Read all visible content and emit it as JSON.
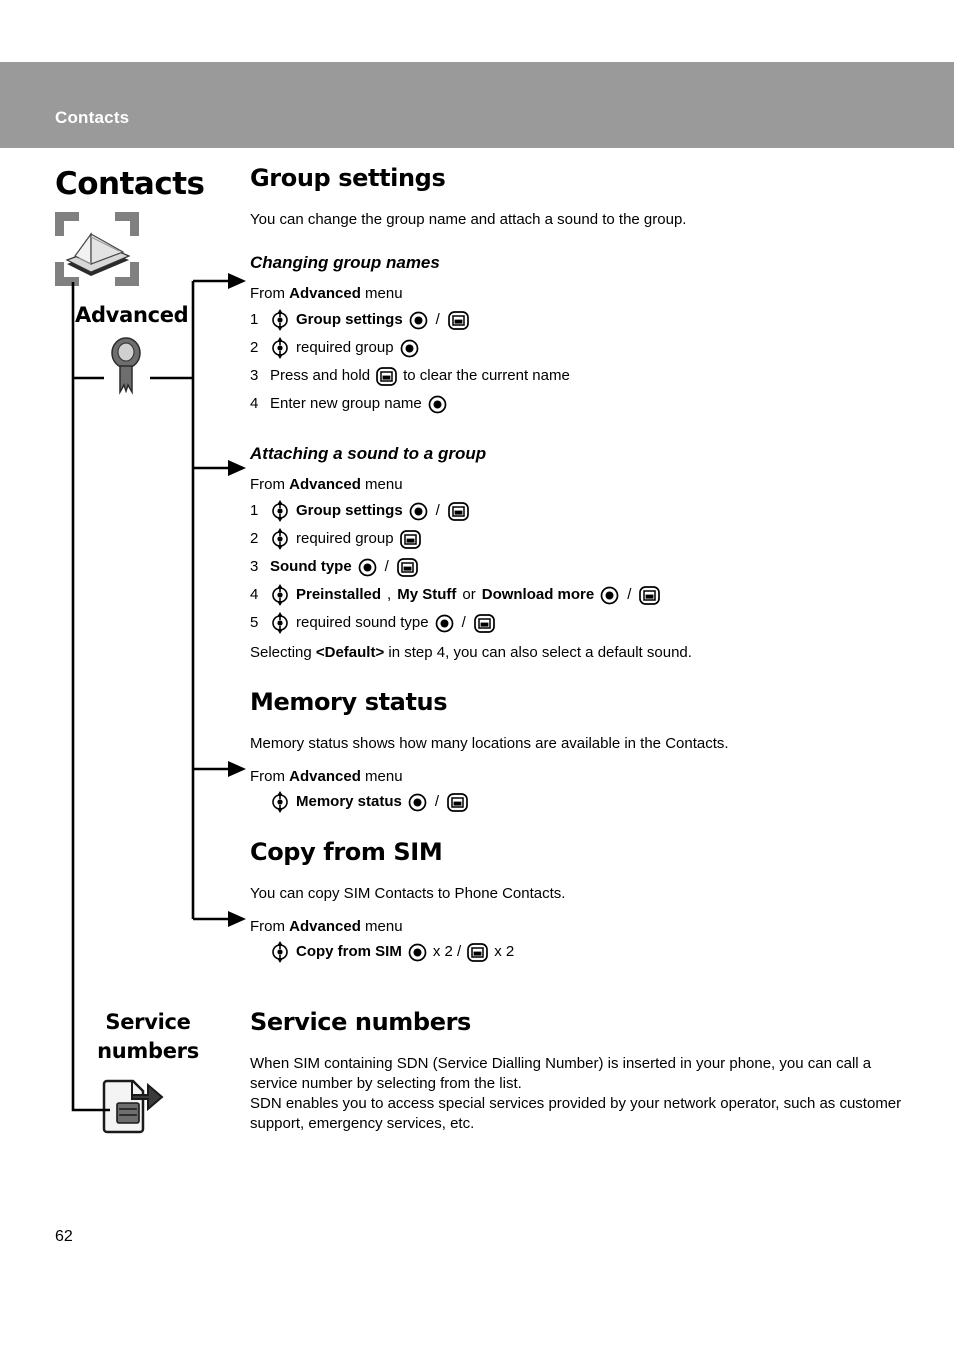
{
  "header": {
    "title": "Contacts"
  },
  "nav": {
    "title": "Contacts",
    "contacts_icon": "rolodex-card-file-icon",
    "advanced_label": "Advanced",
    "advanced_icon": "key-icon",
    "service_label": "Service numbers",
    "service_icon": "sim-card-arrow-icon"
  },
  "icons": {
    "nav_key": "navigation-key-icon",
    "select_key": "select-key-icon",
    "back_key": "back-key-icon"
  },
  "sections": [
    {
      "id": "group-settings",
      "heading": "Group settings",
      "intro": "You can change the group name and attach a sound to the group.",
      "subsections": [
        {
          "id": "changing-group-names",
          "subheading": "Changing group names",
          "from_prefix": "From ",
          "from_bold": "Advanced",
          "from_suffix": " menu",
          "steps": [
            {
              "num": "1",
              "parts": [
                {
                  "t": "icon",
                  "v": "nav"
                },
                {
                  "t": "bold",
                  "v": "Group settings"
                },
                {
                  "t": "icon",
                  "v": "select"
                },
                {
                  "t": "text",
                  "v": "/"
                },
                {
                  "t": "icon",
                  "v": "back"
                }
              ]
            },
            {
              "num": "2",
              "parts": [
                {
                  "t": "icon",
                  "v": "nav"
                },
                {
                  "t": "text",
                  "v": "required group"
                },
                {
                  "t": "icon",
                  "v": "select"
                }
              ]
            },
            {
              "num": "3",
              "parts": [
                {
                  "t": "text",
                  "v": "Press and hold"
                },
                {
                  "t": "icon",
                  "v": "back"
                },
                {
                  "t": "text",
                  "v": "to clear the current name"
                }
              ]
            },
            {
              "num": "4",
              "parts": [
                {
                  "t": "text",
                  "v": "Enter new group name"
                },
                {
                  "t": "icon",
                  "v": "select"
                }
              ]
            }
          ]
        },
        {
          "id": "attaching-a-sound-to-a-group",
          "subheading": "Attaching a sound to a group",
          "from_prefix": "From ",
          "from_bold": "Advanced",
          "from_suffix": " menu",
          "steps": [
            {
              "num": "1",
              "parts": [
                {
                  "t": "icon",
                  "v": "nav"
                },
                {
                  "t": "bold",
                  "v": "Group settings"
                },
                {
                  "t": "icon",
                  "v": "select"
                },
                {
                  "t": "text",
                  "v": "/"
                },
                {
                  "t": "icon",
                  "v": "back"
                }
              ]
            },
            {
              "num": "2",
              "parts": [
                {
                  "t": "icon",
                  "v": "nav"
                },
                {
                  "t": "text",
                  "v": "required group"
                },
                {
                  "t": "icon",
                  "v": "back"
                }
              ]
            },
            {
              "num": "3",
              "parts": [
                {
                  "t": "bold",
                  "v": "Sound type"
                },
                {
                  "t": "icon",
                  "v": "select"
                },
                {
                  "t": "text",
                  "v": "/"
                },
                {
                  "t": "icon",
                  "v": "back"
                }
              ]
            },
            {
              "num": "4",
              "parts": [
                {
                  "t": "icon",
                  "v": "nav"
                },
                {
                  "t": "bold",
                  "v": "Preinstalled"
                },
                {
                  "t": "text",
                  "v": ","
                },
                {
                  "t": "bold",
                  "v": "My Stuff"
                },
                {
                  "t": "text",
                  "v": "or"
                },
                {
                  "t": "bold",
                  "v": "Download more"
                },
                {
                  "t": "icon",
                  "v": "select"
                },
                {
                  "t": "text",
                  "v": "/"
                },
                {
                  "t": "icon",
                  "v": "back"
                }
              ]
            },
            {
              "num": "5",
              "parts": [
                {
                  "t": "icon",
                  "v": "nav"
                },
                {
                  "t": "text",
                  "v": "required sound type"
                },
                {
                  "t": "icon",
                  "v": "select"
                },
                {
                  "t": "text",
                  "v": "/"
                },
                {
                  "t": "icon",
                  "v": "back"
                }
              ]
            }
          ],
          "note_prefix": "Selecting ",
          "note_bold": "<Default>",
          "note_suffix": " in step 4, you can also select a default sound."
        }
      ]
    },
    {
      "id": "memory-status",
      "heading": "Memory status",
      "intro": "Memory status shows how many locations are available in the Contacts.",
      "from_prefix": "From ",
      "from_bold": "Advanced",
      "from_suffix": " menu",
      "steps": [
        {
          "num": "",
          "parts": [
            {
              "t": "icon",
              "v": "nav"
            },
            {
              "t": "bold",
              "v": "Memory status"
            },
            {
              "t": "icon",
              "v": "select"
            },
            {
              "t": "text",
              "v": "/"
            },
            {
              "t": "icon",
              "v": "back"
            }
          ]
        }
      ]
    },
    {
      "id": "copy-from-sim",
      "heading": "Copy from SIM",
      "intro": "You can copy SIM Contacts to Phone Contacts.",
      "from_prefix": "From ",
      "from_bold": "Advanced",
      "from_suffix": " menu",
      "steps": [
        {
          "num": "",
          "parts": [
            {
              "t": "icon",
              "v": "nav"
            },
            {
              "t": "bold",
              "v": "Copy from SIM"
            },
            {
              "t": "icon",
              "v": "select"
            },
            {
              "t": "text",
              "v": "x 2 /"
            },
            {
              "t": "icon",
              "v": "back"
            },
            {
              "t": "text",
              "v": "x 2"
            }
          ]
        }
      ]
    },
    {
      "id": "service-numbers",
      "heading": "Service numbers",
      "paragraphs": [
        "When SIM containing SDN (Service Dialling Number) is inserted in your phone, you can call a service number by selecting from the list.",
        "SDN enables you to access special services provided by your network operator, such as customer support, emergency services, etc."
      ]
    }
  ],
  "page_number": "62",
  "colors": {
    "header_bar": "#9a9a9a",
    "header_text": "#ffffff",
    "body_text": "#000000"
  }
}
